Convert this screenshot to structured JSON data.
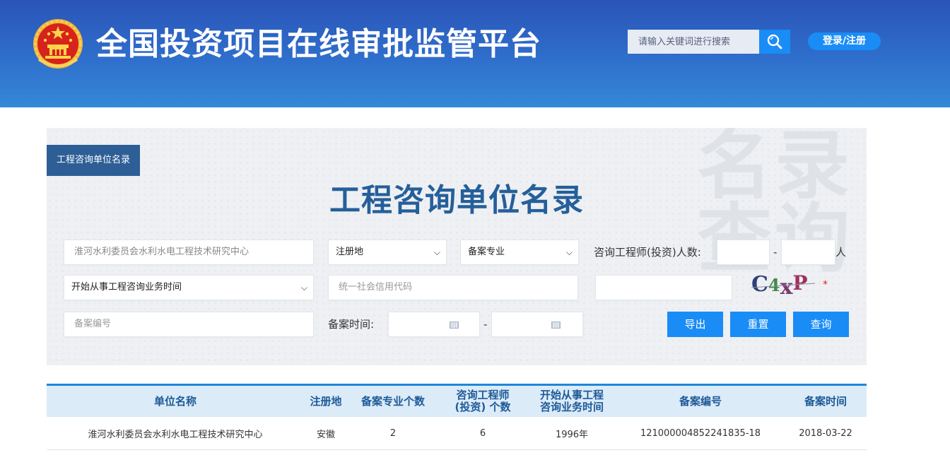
{
  "header": {
    "site_title": "全国投资项目在线审批监管平台",
    "search_placeholder": "请输入关键词进行搜索",
    "login_label": "登录/注册"
  },
  "panel": {
    "tag_label": "工程咨询单位名录",
    "title": "工程咨询单位名录",
    "watermark": "名录查询",
    "unit_name_value": "淮河水利委员会水利水电工程技术研究中心",
    "region_select": "注册地",
    "specialty_select": "备案专业",
    "engineer_count_label": "咨询工程师(投资)人数:",
    "range_dash": "-",
    "unit_suffix": "人",
    "start_time_select": "开始从事工程咨询业务时间",
    "credit_code_placeholder": "统一社会信用代码",
    "captcha_text": "C4xP",
    "required_mark": "*",
    "record_no_placeholder": "备案编号",
    "record_time_label": "备案时间:",
    "date_dash": "-",
    "export_label": "导出",
    "reset_label": "重置",
    "query_label": "查询"
  },
  "table": {
    "headers": [
      "单位名称",
      "注册地",
      "备案专业个数",
      "咨询工程师\n(投资) 个数",
      "开始从事工程\n咨询业务时间",
      "备案编号",
      "备案时间"
    ],
    "rows": [
      [
        "淮河水利委员会水利水电工程技术研究中心",
        "安徽",
        "2",
        "6",
        "1996年",
        "121000004852241835-18",
        "2018-03-22"
      ]
    ]
  },
  "colors": {
    "header_bg": "#2f6fcc",
    "accent_blue": "#1a8cf5",
    "title_blue": "#255f9a",
    "table_header_bg": "#dcebf8"
  }
}
